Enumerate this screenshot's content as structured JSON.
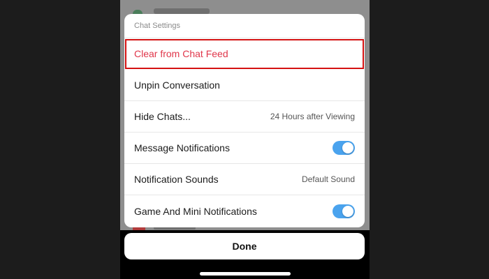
{
  "sheet": {
    "title": "Chat Settings",
    "rows": [
      {
        "label": "Clear from Chat Feed"
      },
      {
        "label": "Unpin Conversation"
      },
      {
        "label": "Hide Chats...",
        "value": "24 Hours after Viewing"
      },
      {
        "label": "Message Notifications",
        "toggle": true
      },
      {
        "label": "Notification Sounds",
        "value": "Default Sound"
      },
      {
        "label": "Game And Mini Notifications",
        "toggle": true
      }
    ]
  },
  "done_label": "Done",
  "colors": {
    "destructive": "#e0364a",
    "highlight_border": "#d41212",
    "toggle_on": "#4aa3ee"
  }
}
